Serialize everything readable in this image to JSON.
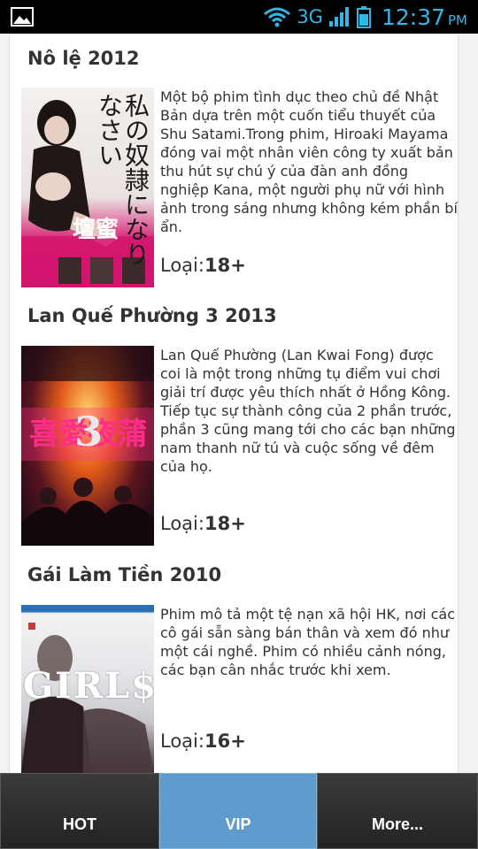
{
  "status_bar": {
    "network": "3G",
    "time": "12:37",
    "ampm": "PM"
  },
  "movies": [
    {
      "title": "Nô lệ 2012",
      "description": "Một bộ phim tình dục theo chủ đề Nhật Bản dựa trên một cuốn tiểu thuyết của Shu Satami.Trong phim, Hiroaki Mayama đóng vai một nhân viên công ty xuất bản thu hút sự chú ý của đàn anh đồng nghiệp Kana, một người phụ nữ với hình ảnh trong sáng nhưng không kém phần bí ẩn.",
      "rating_label": "Loại:",
      "rating_value": "18+",
      "poster_text": "私の奴隷になりなさい",
      "poster_caption": "壇蜜"
    },
    {
      "title": "Lan Quế Phường 3 2013",
      "description": "Lan Quế Phường (Lan Kwai Fong) được coi là một trong những tụ điểm vui chơi giải trí được yêu thích nhất ở Hồng Kông. Tiếp tục sự thành công của 2 phần trước, phần 3 cũng mang tới cho các bạn những nam thanh nữ tú và cuộc sống về đêm của họ.",
      "rating_label": "Loại:",
      "rating_value": "18+",
      "poster_text": "喜愛夜蒲",
      "poster_number": "3"
    },
    {
      "title": "Gái Làm Tiền 2010",
      "description": "Phim mô tả một tệ nạn xã hội HK, nơi các cô gái sẵn sàng bán thân và xem đó như một cái nghề. Phim có nhiều cảnh nóng, các bạn cân nhắc trước khi xem.",
      "rating_label": "Loại:",
      "rating_value": "16+",
      "poster_text": "GIRL$"
    }
  ],
  "tabs": [
    {
      "label": "HOT",
      "active": false
    },
    {
      "label": "VIP",
      "active": true
    },
    {
      "label": "More...",
      "active": false
    }
  ],
  "colors": {
    "status_accent": "#33b5e5",
    "tab_active": "#5f9ccd",
    "tab_inactive": "#2e2e2e"
  }
}
